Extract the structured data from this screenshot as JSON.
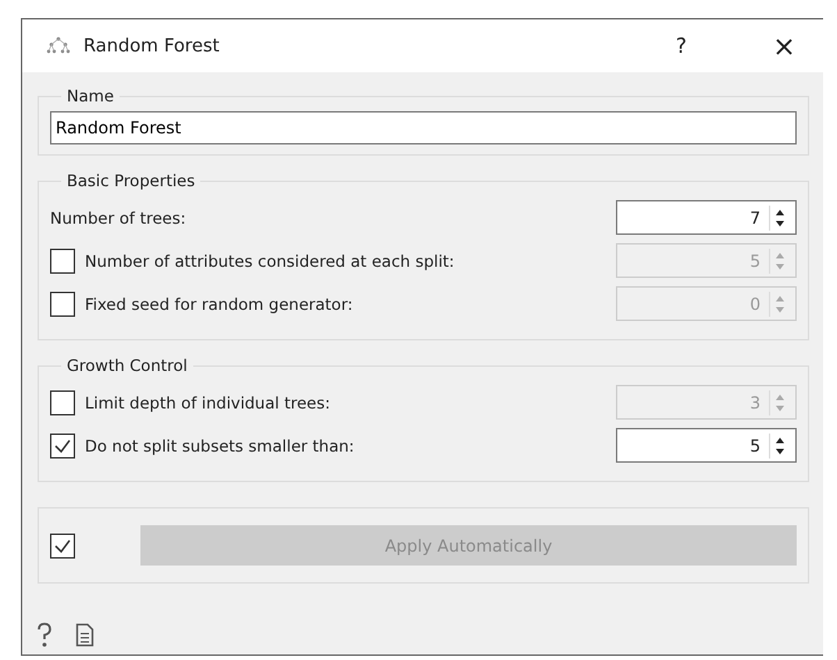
{
  "window": {
    "title": "Random Forest",
    "help": "?",
    "close": "×"
  },
  "name_group": {
    "title": "Name",
    "value": "Random Forest"
  },
  "groups": [
    {
      "title": "Basic Properties",
      "rows": [
        {
          "kind": "spin",
          "label": "Number of trees:",
          "value": "7"
        },
        {
          "kind": "checkbox",
          "label": "Number of attributes considered at each split:",
          "checked": false,
          "value": "5"
        },
        {
          "kind": "checkbox",
          "label": "Fixed seed for random generator:",
          "checked": false,
          "value": "0"
        }
      ]
    },
    {
      "title": "Growth Control",
      "rows": [
        {
          "kind": "checkbox",
          "label": "Limit depth of individual trees:",
          "checked": false,
          "value": "3"
        },
        {
          "kind": "checkbox",
          "label": "Do not split subsets smaller than:",
          "checked": true,
          "value": "5"
        }
      ]
    }
  ],
  "auto_apply": {
    "checked": true,
    "label": "Apply Automatically",
    "disabled": true
  }
}
